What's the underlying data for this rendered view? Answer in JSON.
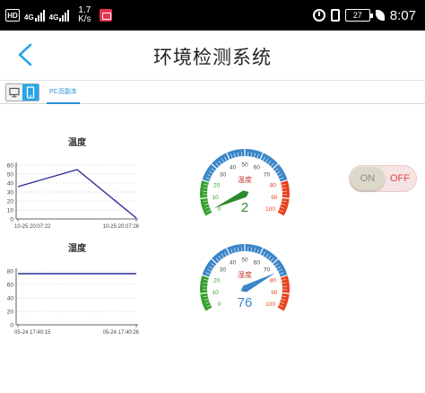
{
  "status_bar": {
    "hd_label": "HD",
    "network_1": "4G",
    "network_2": "4G",
    "speed_value": "1.7",
    "speed_unit": "K/s",
    "battery": "27",
    "time": "8:07"
  },
  "header": {
    "title": "环境检测系统"
  },
  "tabs": {
    "pc_tab_label": "PC页副本"
  },
  "switch": {
    "on_label": "ON",
    "off_label": "OFF",
    "state": "off"
  },
  "colors": {
    "accent": "#29a6e8",
    "chart_line": "#2d2d9a",
    "gauge_blue": "#3a86c8",
    "gauge_green": "#35a02e",
    "gauge_red": "#e8421f",
    "needle_green": "#2c8a2c",
    "needle_blue": "#3a86c8"
  },
  "chart_data": [
    {
      "type": "line",
      "title": "温度",
      "x": [
        "10-25 20:07:22",
        "",
        "10-25 20:07:26"
      ],
      "series": [
        {
          "values": [
            36,
            55,
            1
          ]
        }
      ],
      "ylim": [
        0,
        60
      ],
      "yticks": [
        0,
        10,
        20,
        30,
        40,
        50,
        60
      ],
      "xtick_labels": [
        "10-25 20:07:22",
        "10-25 20:07:26"
      ],
      "grid": true
    },
    {
      "type": "line",
      "title": "湿度",
      "x": [
        "05-24 17:40:15",
        "05-24 17:40:26"
      ],
      "series": [
        {
          "values": [
            76,
            76
          ]
        }
      ],
      "ylim": [
        0,
        80
      ],
      "yticks": [
        0,
        20,
        40,
        60,
        80
      ],
      "xtick_labels": [
        "05-24 17:40:15",
        "05-24 17:40:26"
      ],
      "grid": true
    }
  ],
  "gauges": [
    {
      "title": "温度",
      "value": 2,
      "value_text": "2",
      "min": 0,
      "max": 100,
      "ticks": [
        "0",
        "10",
        "20",
        "30",
        "40",
        "50",
        "60",
        "70",
        "80",
        "90",
        "100"
      ],
      "needle_color": "#2c8a2c",
      "value_color": "#2c8a2c"
    },
    {
      "title": "湿度",
      "value": 76,
      "value_text": "76",
      "min": 0,
      "max": 100,
      "ticks": [
        "0",
        "10",
        "20",
        "30",
        "40",
        "50",
        "60",
        "70",
        "80",
        "90",
        "100"
      ],
      "needle_color": "#3a86c8",
      "value_color": "#3a86c8"
    }
  ]
}
